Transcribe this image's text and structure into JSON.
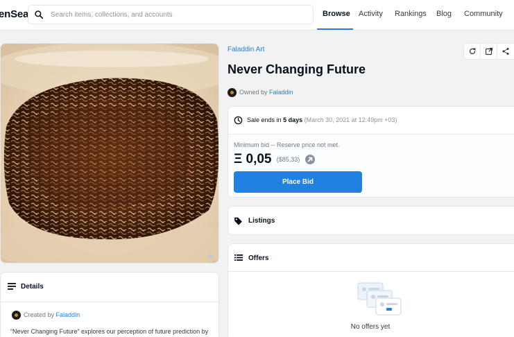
{
  "header": {
    "logo_text": "enSea",
    "search_placeholder": "Search items, collections, and accounts",
    "nav": [
      {
        "label": "Browse"
      },
      {
        "label": "Activity"
      },
      {
        "label": "Rankings"
      },
      {
        "label": "Blog"
      },
      {
        "label": "Community"
      }
    ]
  },
  "item": {
    "collection": "Faladdin Art",
    "title": "Never Changing Future",
    "owned_by_prefix": "Owned by",
    "owner": "Faladdin"
  },
  "sale": {
    "ends_prefix": "Sale ends in",
    "ends_in": "5 days",
    "ends_date": "(March 30, 2021 at 12:49pm +03)",
    "min_bid_note": "Minimum bid -- Reserve price not met.",
    "currency_symbol": "Ξ",
    "price": "0,05",
    "price_usd": "($85,33)",
    "place_bid_label": "Place Bid"
  },
  "listings": {
    "label": "Listings"
  },
  "offers": {
    "label": "Offers",
    "empty_text": "No offers yet"
  },
  "details": {
    "label": "Details",
    "created_by_prefix": "Created by",
    "creator": "Faladdin",
    "description": "“Never Changing Future” explores our perception of future prediction by"
  },
  "colors": {
    "accent": "#2081e2",
    "text": "#04111d",
    "muted": "#707a83"
  }
}
